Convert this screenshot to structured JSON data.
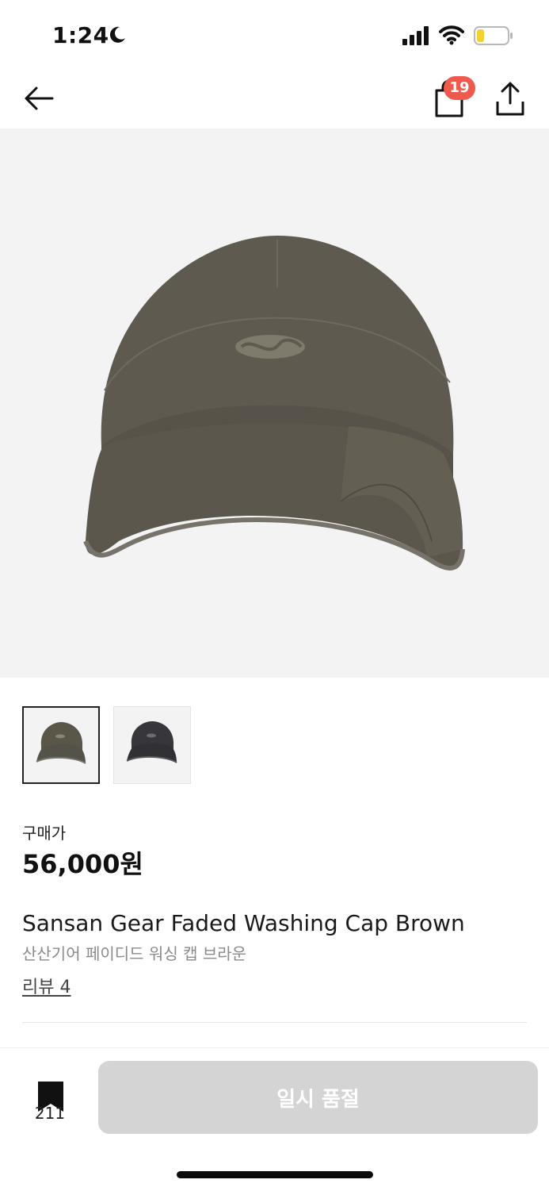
{
  "status_bar": {
    "time": "1:24",
    "icons": [
      "moon-icon",
      "signal-icon",
      "wifi-icon",
      "battery-icon"
    ],
    "battery_color": "#f2d230"
  },
  "nav": {
    "icons": [
      "back-arrow-icon",
      "shopping-bag-icon",
      "share-icon"
    ],
    "cart_count": "19",
    "badge_color": "#ef5a4e"
  },
  "product": {
    "price_label": "구매가",
    "price": "56,000원",
    "name": "Sansan Gear Faded Washing Cap Brown",
    "name_ko": "산산기어 페이디드 워싱 캡 브라운",
    "review_link": "리뷰 4",
    "cap_color": "#5e5a4f",
    "thumbnails": [
      {
        "color": "brown",
        "cap_color": "#5a5749",
        "selected": true
      },
      {
        "color": "black",
        "cap_color": "#36363b",
        "selected": false
      }
    ]
  },
  "bottom_bar": {
    "bookmark_count": "211",
    "buy_label": "일시 품절",
    "buy_button_color": "#d4d4d4"
  }
}
